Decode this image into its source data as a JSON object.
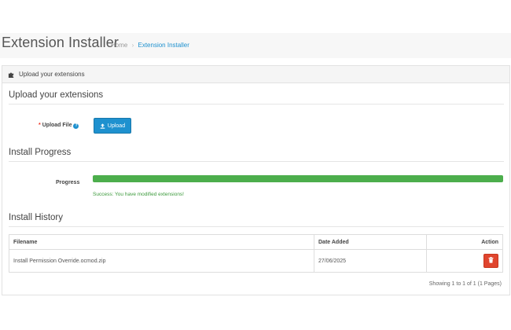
{
  "header": {
    "title": "Extension Installer",
    "breadcrumb": {
      "home": "Home",
      "separator": "›",
      "current": "Extension Installer"
    }
  },
  "panel": {
    "heading_icon": "puzzle-icon",
    "heading": "Upload your extensions"
  },
  "upload_section": {
    "title": "Upload your extensions",
    "required_mark": "*",
    "field_label": "Upload File",
    "info_icon": "question-circle-icon",
    "button_label": "Upload",
    "button_icon": "upload-icon"
  },
  "progress_section": {
    "title": "Install Progress",
    "label": "Progress",
    "progress_fraction": 1.0,
    "status_text": "Success: You have modified extensions!"
  },
  "history_section": {
    "title": "Install History",
    "columns": {
      "filename": "Filename",
      "date_added": "Date Added",
      "action": "Action"
    },
    "rows": [
      {
        "filename": "Install Permission Override.ocmod.zip",
        "date_added": "27/06/2025",
        "action_icon": "trash-icon"
      }
    ],
    "pagination": "Showing 1 to 1 of 1 (1 Pages)"
  },
  "colors": {
    "primary": "#1e91cf",
    "success": "#4cae4c",
    "danger": "#e0452e"
  }
}
